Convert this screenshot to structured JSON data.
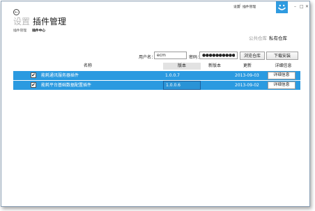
{
  "titlebar": {
    "settings_link": "设置",
    "separator": "|",
    "plugin_link": "插件管理",
    "logo_icon": "smiley-face-icon",
    "minimize": "–",
    "maximize": "□",
    "close": "✕"
  },
  "page": {
    "back_icon": "←",
    "title_setting": "设置",
    "title_plugin": "插件管理",
    "breadcrumb_plugin_mgmt": "插件管理",
    "breadcrumb_plugin_center": "插件中心"
  },
  "repo": {
    "public_label": "公共仓库",
    "private_label": "私有仓库"
  },
  "login": {
    "username_label": "用户名：",
    "username_value": "ecm",
    "password_label": "密码：",
    "password_value": "●●●●●●●●●●●●",
    "browse_button": "浏览仓库",
    "download_button": "下载安装"
  },
  "table": {
    "headers": {
      "name": "名称",
      "version": "版本",
      "new_version": "新版本",
      "updated": "更新",
      "details": "详细信息"
    },
    "rows": [
      {
        "checked": "✔",
        "name": "能耗通讯服务器插件",
        "version": "1.0.0.7",
        "new_version": "",
        "updated": "2013-09-03",
        "detail_button": "详细信息"
      },
      {
        "checked": "✔",
        "name": "能耗平台基础数据配置插件",
        "version": "1.0.0.6",
        "new_version": "",
        "updated": "2013-09-02",
        "detail_button": "详细信息"
      }
    ]
  },
  "colors": {
    "accent": "#2b9ae0",
    "header_highlight": "#e2e2e2"
  }
}
